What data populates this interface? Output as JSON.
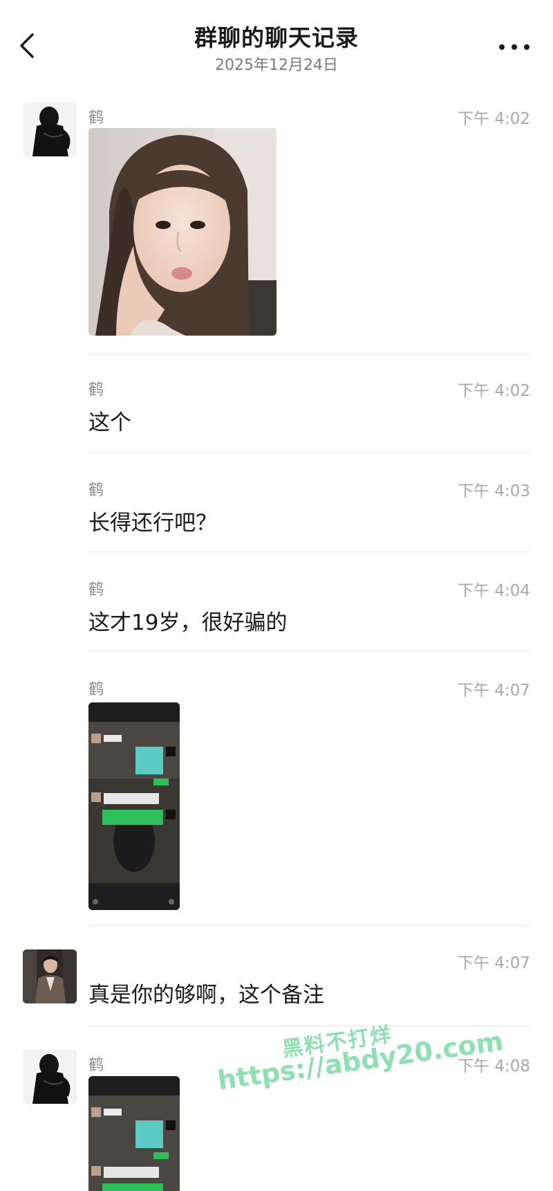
{
  "header": {
    "title": "群聊的聊天记录",
    "date": "2025年12月24日"
  },
  "messages": [
    {
      "sender": "鹤",
      "time": "下午 4:02",
      "type": "image",
      "image": "selfie of a girl"
    },
    {
      "sender": "鹤",
      "time": "下午 4:02",
      "type": "text",
      "text": "这个"
    },
    {
      "sender": "鹤",
      "time": "下午 4:03",
      "type": "text",
      "text": "长得还行吧？"
    },
    {
      "sender": "鹤",
      "time": "下午 4:04",
      "type": "text",
      "text": "这才19岁，很好骗的"
    },
    {
      "sender": "鹤",
      "time": "下午 4:07",
      "type": "image",
      "image": "chat screenshot"
    },
    {
      "sender": "",
      "time": "下午 4:07",
      "type": "text",
      "text": "真是你的够啊，这个备注"
    },
    {
      "sender": "鹤",
      "time": "下午 4:08",
      "type": "image",
      "image": "chat screenshot"
    }
  ],
  "watermark": {
    "line1": "黑料不打烊",
    "line2": "https://abdy20.com"
  },
  "colors": {
    "text_primary": "#1a1a1a",
    "text_secondary": "#8b8b8b",
    "time": "#a8a8a8",
    "divider": "#e6e6e6",
    "watermark": "#8ee0b0",
    "chat_green": "#2fbf58"
  },
  "icons": {
    "back": "chevron-left-icon",
    "more": "more-dots-icon"
  }
}
